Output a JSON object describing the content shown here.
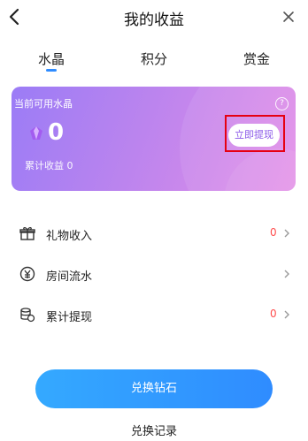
{
  "header": {
    "title": "我的收益"
  },
  "tabs": [
    {
      "label": "水晶",
      "active": true
    },
    {
      "label": "积分",
      "active": false
    },
    {
      "label": "赏金",
      "active": false
    }
  ],
  "card": {
    "label": "当前可用水晶",
    "help": "?",
    "balance": "0",
    "withdraw_label": "立即提现",
    "cumulative": "累计收益 0"
  },
  "list": [
    {
      "label": "礼物收入",
      "count": "0",
      "icon": "gift-icon"
    },
    {
      "label": "房间流水",
      "count": "",
      "icon": "yuan-circle-icon"
    },
    {
      "label": "累计提现",
      "count": "0",
      "icon": "coin-stack-icon"
    }
  ],
  "footer": {
    "cta_label": "兑换钻石",
    "history_label": "兑换记录"
  },
  "colors": {
    "accent": "#2f8cff",
    "card_start": "#9b7cf6",
    "card_end": "#e48fe8",
    "highlight": "#e60012",
    "count": "#ff4d4d"
  }
}
